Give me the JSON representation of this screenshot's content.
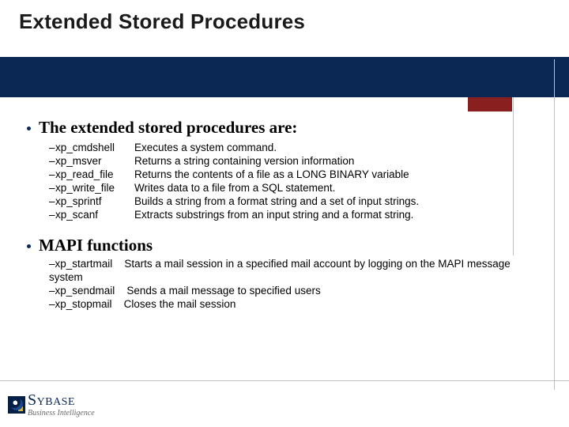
{
  "title": "Extended Stored Procedures",
  "sections": [
    {
      "heading": "The extended stored procedures are:",
      "items": [
        {
          "name": "xp_cmdshell",
          "desc": "Executes a system command."
        },
        {
          "name": "xp_msver",
          "desc": "Returns a string containing version information"
        },
        {
          "name": "xp_read_file",
          "desc": "Returns the contents of a file as a LONG BINARY variable"
        },
        {
          "name": "xp_write_file",
          "desc": "Writes data to a file from a SQL statement."
        },
        {
          "name": "xp_sprintf",
          "desc": "Builds a string from a format string and a set of input strings."
        },
        {
          "name": "xp_scanf",
          "desc": "Extracts substrings from an input string and a format string."
        }
      ]
    },
    {
      "heading": "MAPI functions",
      "items": [
        {
          "name": "xp_startmail",
          "desc": "Starts a mail session in a specified mail account by logging on the MAPI message system"
        },
        {
          "name": "xp_sendmail",
          "desc": "Sends a mail message to specified users"
        },
        {
          "name": "xp_stopmail",
          "desc": "Closes the mail session"
        }
      ]
    }
  ],
  "logo": {
    "name_prefix": "S",
    "name_mid": "YBASE",
    "tagline": "Business Intelligence"
  },
  "glyphs": {
    "dash": "–"
  }
}
